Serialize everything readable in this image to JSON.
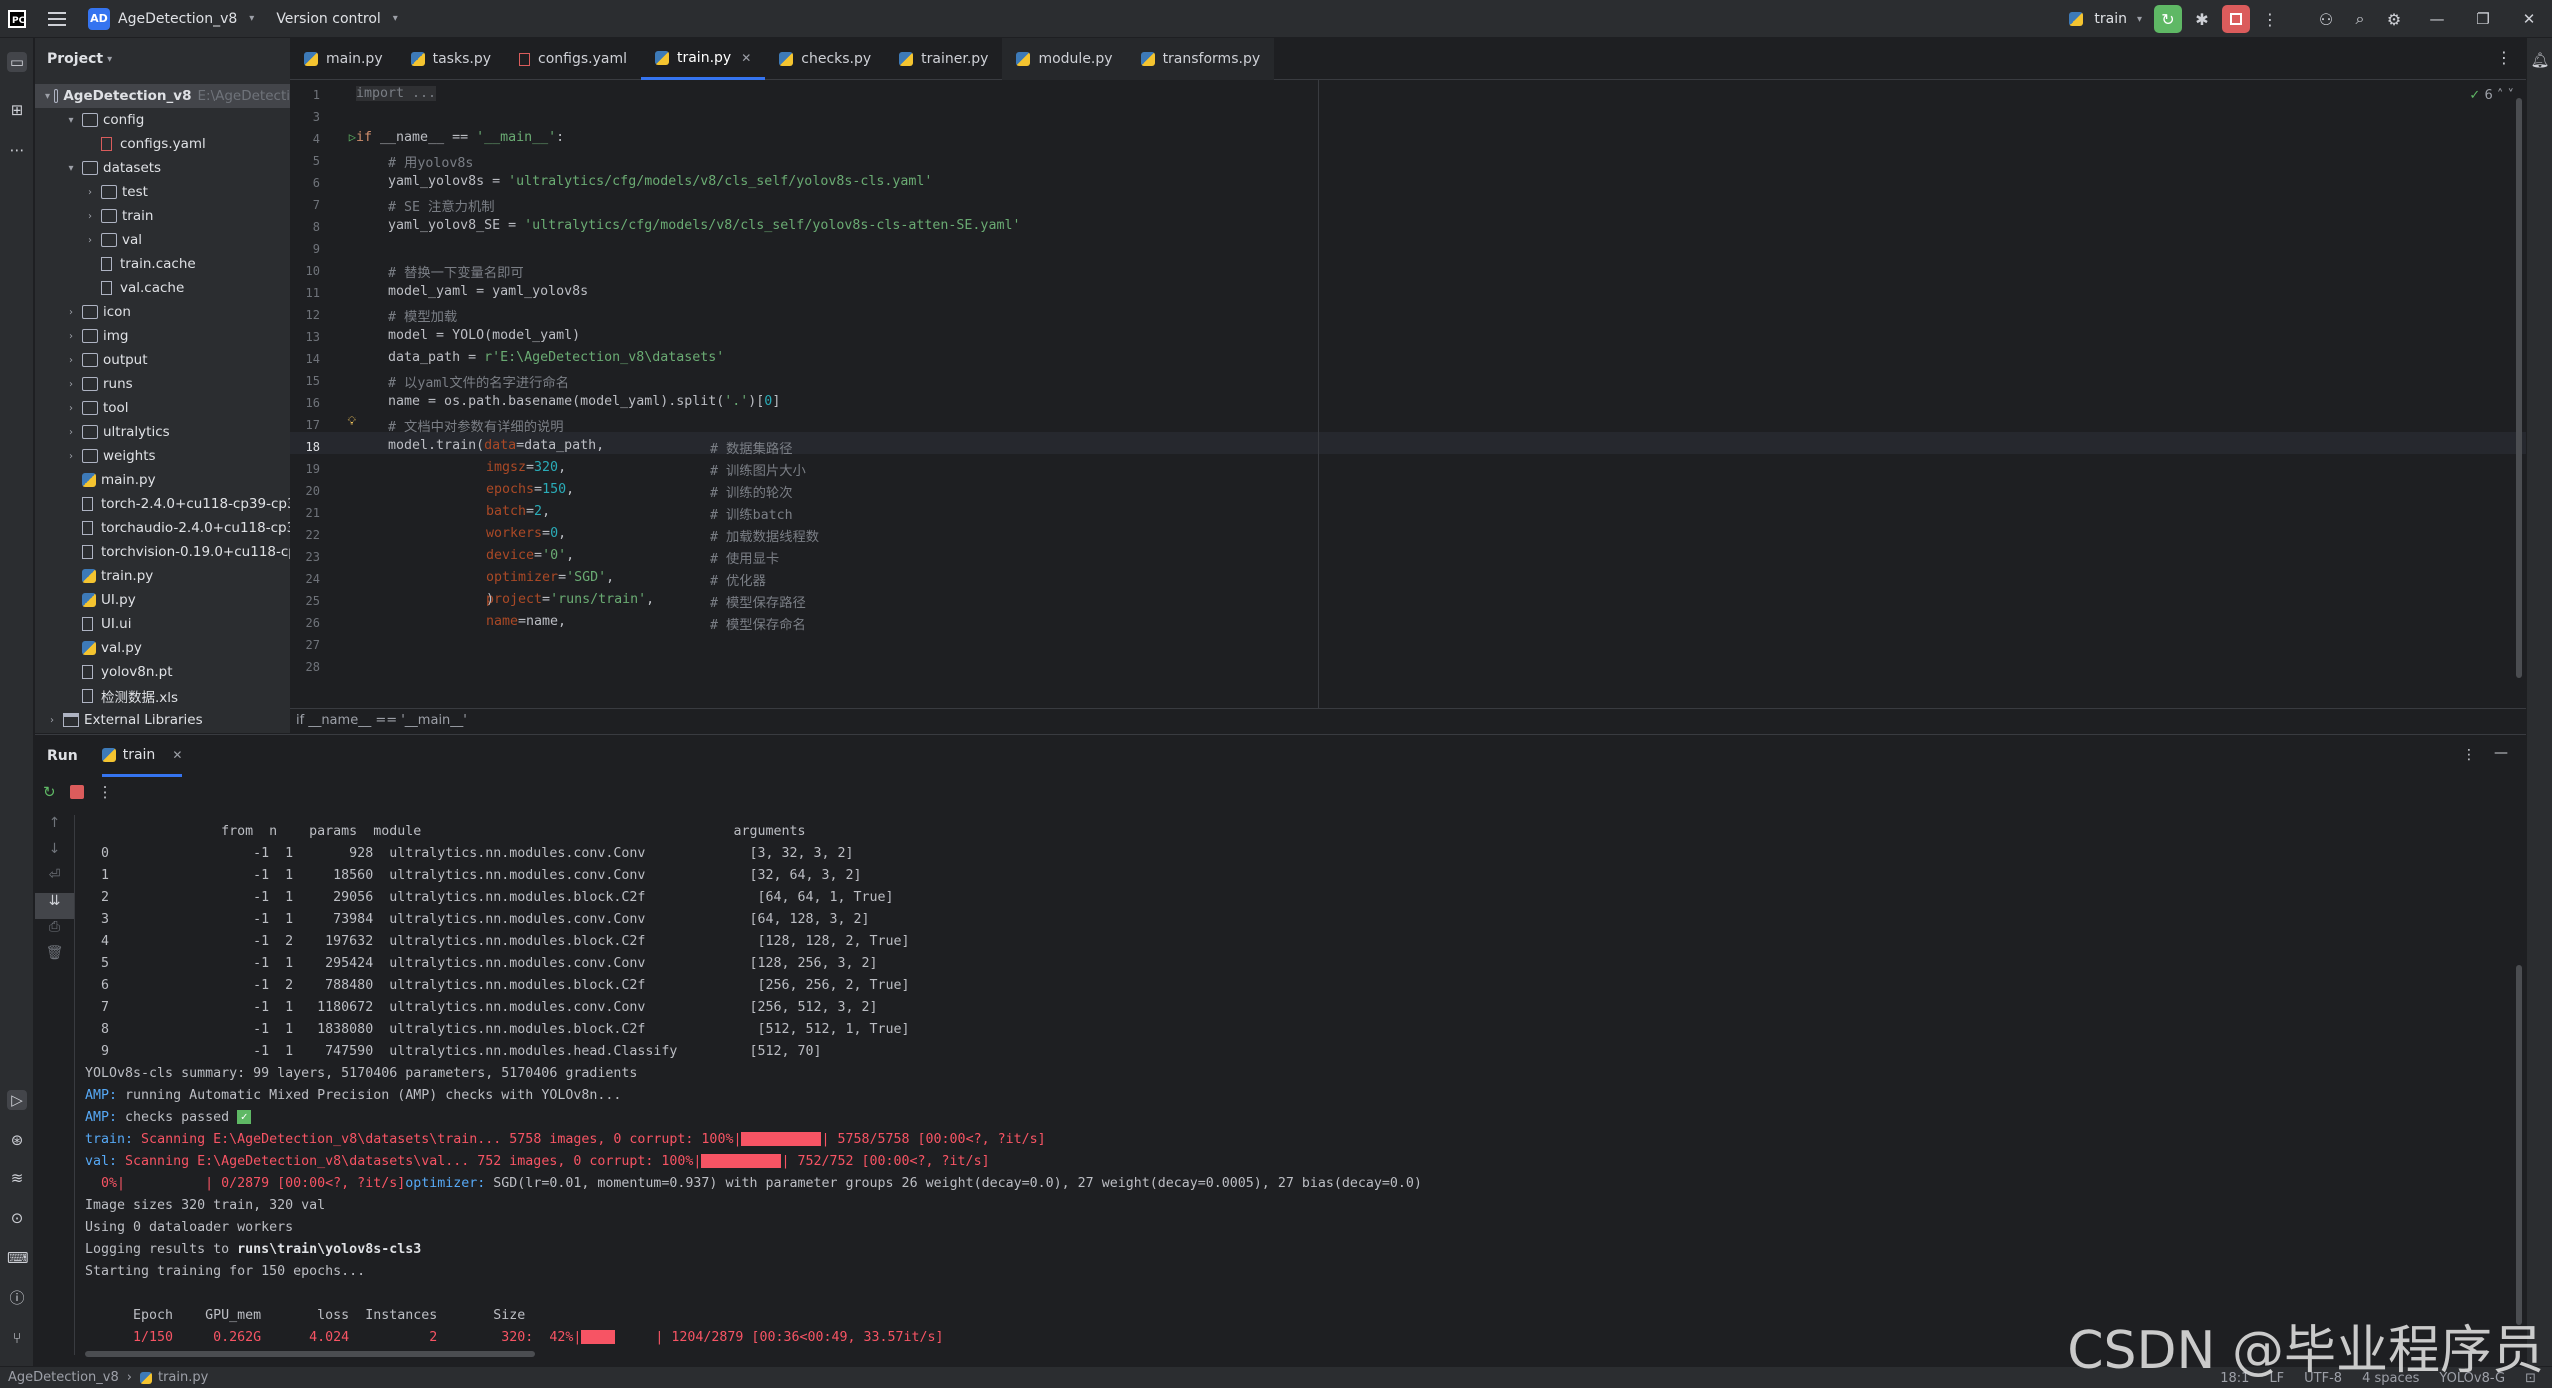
{
  "titlebar": {
    "project_badge": "AD",
    "project_name": "AgeDetection_v8",
    "version_control": "Version control",
    "run_config": "train",
    "window_controls": [
      "—",
      "❐",
      "✕"
    ]
  },
  "project_panel": {
    "title": "Project",
    "root": "AgeDetection_v8",
    "root_path": "E:\\AgeDetecti",
    "items": [
      {
        "label": "config",
        "type": "folder",
        "depth": 1,
        "expanded": true
      },
      {
        "label": "configs.yaml",
        "type": "yaml",
        "depth": 2
      },
      {
        "label": "datasets",
        "type": "folder",
        "depth": 1,
        "expanded": true
      },
      {
        "label": "test",
        "type": "folder",
        "depth": 2
      },
      {
        "label": "train",
        "type": "folder",
        "depth": 2
      },
      {
        "label": "val",
        "type": "folder",
        "depth": 2
      },
      {
        "label": "train.cache",
        "type": "file",
        "depth": 2
      },
      {
        "label": "val.cache",
        "type": "file",
        "depth": 2
      },
      {
        "label": "icon",
        "type": "folder",
        "depth": 1
      },
      {
        "label": "img",
        "type": "folder",
        "depth": 1
      },
      {
        "label": "output",
        "type": "folder",
        "depth": 1
      },
      {
        "label": "runs",
        "type": "folder",
        "depth": 1
      },
      {
        "label": "tool",
        "type": "folder",
        "depth": 1
      },
      {
        "label": "ultralytics",
        "type": "folder",
        "depth": 1
      },
      {
        "label": "weights",
        "type": "folder",
        "depth": 1
      },
      {
        "label": "main.py",
        "type": "py",
        "depth": 1
      },
      {
        "label": "torch-2.4.0+cu118-cp39-cp3",
        "type": "file",
        "depth": 1
      },
      {
        "label": "torchaudio-2.4.0+cu118-cp3",
        "type": "file",
        "depth": 1
      },
      {
        "label": "torchvision-0.19.0+cu118-cp",
        "type": "file",
        "depth": 1
      },
      {
        "label": "train.py",
        "type": "py",
        "depth": 1
      },
      {
        "label": "UI.py",
        "type": "py",
        "depth": 1
      },
      {
        "label": "UI.ui",
        "type": "file",
        "depth": 1
      },
      {
        "label": "val.py",
        "type": "py",
        "depth": 1
      },
      {
        "label": "yolov8n.pt",
        "type": "file",
        "depth": 1
      },
      {
        "label": "检测数据.xls",
        "type": "file",
        "depth": 1
      }
    ],
    "external": "External Libraries"
  },
  "tabs": [
    {
      "label": "main.py",
      "type": "py"
    },
    {
      "label": "tasks.py",
      "type": "py"
    },
    {
      "label": "configs.yaml",
      "type": "yaml"
    },
    {
      "label": "train.py",
      "type": "py",
      "active": true
    },
    {
      "label": "checks.py",
      "type": "py"
    },
    {
      "label": "trainer.py",
      "type": "py"
    },
    {
      "label": "module.py",
      "type": "py",
      "dimmed": true
    },
    {
      "label": "transforms.py",
      "type": "py",
      "dimmed": true
    }
  ],
  "editor": {
    "inspection_count": "6",
    "breadcrumb": "if __name__ == '__main__'",
    "line_numbers": [
      "1",
      "3",
      "4",
      "5",
      "6",
      "7",
      "8",
      "9",
      "10",
      "11",
      "12",
      "13",
      "14",
      "15",
      "16",
      "17",
      "18",
      "19",
      "20",
      "21",
      "22",
      "23",
      "24",
      "25",
      "26",
      "27",
      "28"
    ],
    "lines": {
      "l1": "import ...",
      "l4a": "if ",
      "l4b": "__name__ == ",
      "l4c": "'__main__'",
      "l4d": ":",
      "l5": "    # 用yolov8s",
      "l6a": "    yaml_yolov8s = ",
      "l6b": "'ultralytics/cfg/models/v8/cls_self/yolov8s-cls.yaml'",
      "l7": "    # SE 注意力机制",
      "l8a": "    yaml_yolov8_SE = ",
      "l8b": "'ultralytics/cfg/models/v8/cls_self/yolov8s-cls-atten-SE.yaml'",
      "l10": "    # 替换一下变量名即可",
      "l11": "    model_yaml = yaml_yolov8s",
      "l12": "    # 模型加载",
      "l13": "    model = YOLO(model_yaml)",
      "l14a": "    data_path = ",
      "l14b": "r'E:\\AgeDetection_v8\\datasets'",
      "l15": "    # 以yaml文件的名字进行命名",
      "l16a": "    name = os.path.basename(model_yaml).split(",
      "l16b": "'.'",
      "l16c": ")[",
      "l16d": "0",
      "l16e": "]",
      "l17": "    # 文档中对参数有详细的说明",
      "l18a": "    model.train(",
      "l18b": "data",
      "l18c": "=data_path,",
      "l18d": "# 数据集路径",
      "l19a": "imgsz",
      "l19b": "=",
      "l19c": "320",
      "l19d": ",",
      "l19e": "# 训练图片大小",
      "l20a": "epochs",
      "l20b": "=",
      "l20c": "150",
      "l20d": ",",
      "l20e": "# 训练的轮次",
      "l21a": "batch",
      "l21b": "=",
      "l21c": "2",
      "l21d": ",",
      "l21e": "# 训练batch",
      "l22a": "workers",
      "l22b": "=",
      "l22c": "0",
      "l22d": ",",
      "l22e": "# 加载数据线程数",
      "l23a": "device",
      "l23b": "=",
      "l23c": "'0'",
      "l23d": ",",
      "l23e": "# 使用显卡",
      "l24a": "optimizer",
      "l24b": "=",
      "l24c": "'SGD'",
      "l24d": ",",
      "l24e": "# 优化器",
      "l25a": "project",
      "l25b": "=",
      "l25c": "'runs/train'",
      "l25d": ",",
      "l25e": "# 模型保存路径",
      "l26a": "name",
      "l26b": "=name,",
      "l26e": "# 模型保存命名",
      "l27": ")"
    }
  },
  "run": {
    "title": "Run",
    "tab": "train",
    "header": "                 from  n    params  module                                       arguments",
    "layers": [
      "  0                  -1  1       928  ultralytics.nn.modules.conv.Conv             [3, 32, 3, 2]",
      "  1                  -1  1     18560  ultralytics.nn.modules.conv.Conv             [32, 64, 3, 2]",
      "  2                  -1  1     29056  ultralytics.nn.modules.block.C2f              [64, 64, 1, True]",
      "  3                  -1  1     73984  ultralytics.nn.modules.conv.Conv             [64, 128, 3, 2]",
      "  4                  -1  2    197632  ultralytics.nn.modules.block.C2f              [128, 128, 2, True]",
      "  5                  -1  1    295424  ultralytics.nn.modules.conv.Conv             [128, 256, 3, 2]",
      "  6                  -1  2    788480  ultralytics.nn.modules.block.C2f              [256, 256, 2, True]",
      "  7                  -1  1   1180672  ultralytics.nn.modules.conv.Conv             [256, 512, 3, 2]",
      "  8                  -1  1   1838080  ultralytics.nn.modules.block.C2f              [512, 512, 1, True]",
      "  9                  -1  1    747590  ultralytics.nn.modules.head.Classify         [512, 70]"
    ],
    "summary": "YOLOv8s-cls summary: 99 layers, 5170406 parameters, 5170406 gradients",
    "amp1_tag": "AMP:",
    "amp1_text": " running Automatic Mixed Precision (AMP) checks with YOLOv8n...",
    "amp2_tag": "AMP:",
    "amp2_text": " checks passed ",
    "train_scan_tag": "train:",
    "train_scan_a": " Scanning E:\\AgeDetection_v8\\datasets\\train... 5758 images, 0 corrupt: 100%|",
    "train_scan_b": "| 5758/5758 [00:00<?, ?it/s]",
    "val_scan_tag": "val:",
    "val_scan_a": " Scanning E:\\AgeDetection_v8\\datasets\\val... 752 images, 0 corrupt: 100%|",
    "val_scan_b": "| 752/752 [00:00<?, ?it/s]",
    "opt_a": "  0%|          | 0/2879 [00:00<?, ?it/s]",
    "opt_tag": "optimizer:",
    "opt_b": " SGD(lr=0.01, momentum=0.937) with parameter groups 26 weight(decay=0.0), 27 weight(decay=0.0005), 27 bias(decay=0.0)",
    "img_sizes": "Image sizes 320 train, 320 val",
    "workers": "Using 0 dataloader workers",
    "logging_a": "Logging results to ",
    "logging_b": "runs\\train\\yolov8s-cls3",
    "starting": "Starting training for 150 epochs...",
    "epoch_header": "      Epoch    GPU_mem       loss  Instances       Size",
    "epoch_row_a": "      1/150     0.262G      4.024          2        320:  42%|",
    "epoch_row_b": "     | 1204/2879 [00:36<00:49, 33.57it/s]",
    "progress_fraction": 0.42
  },
  "statusbar": {
    "project": "AgeDetection_v8",
    "file": "train.py",
    "position": "18:1",
    "line_sep": "LF",
    "encoding": "UTF-8",
    "indent": "4 spaces",
    "interpreter": "YOLOv8-G"
  },
  "watermark": "CSDN @毕业程序员"
}
